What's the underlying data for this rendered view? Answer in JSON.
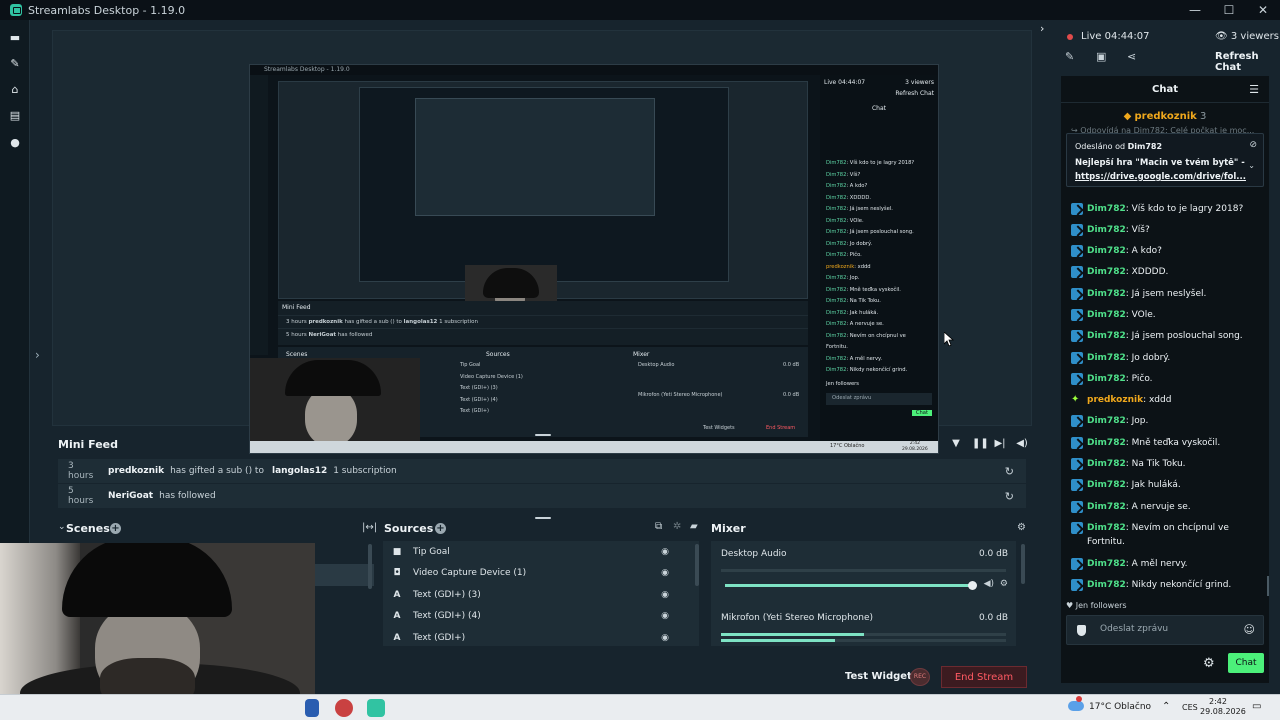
{
  "window": {
    "title": "Streamlabs Desktop - 1.19.0",
    "controls": [
      "—",
      "☐",
      "✕"
    ]
  },
  "nav": {
    "icons": [
      "studio-icon",
      "themes-icon",
      "store-icon",
      "layout-icon",
      "play-icon"
    ]
  },
  "preview": {
    "mini": {
      "title": "Streamlabs Desktop - 1.19.0",
      "live": "Live 04:44:07",
      "viewers": "3 viewers",
      "refresh": "Refresh Chat",
      "chat_title": "Chat",
      "feed_title": "Mini Feed",
      "feed_rows": [
        {
          "time": "3 hours",
          "user": "predkoznik",
          "text": "has gifted a sub () to",
          "target": "langolas12",
          "extra": "1 subscription"
        },
        {
          "time": "5 hours",
          "user": "NeriGoat",
          "text": "has followed"
        }
      ],
      "scenes": "Scenes",
      "sources": "Sources",
      "mixer": "Mixer",
      "source_items": [
        "Tip Goal",
        "Video Capture Device (1)",
        "Text (GDI+) (3)",
        "Text (GDI+) (4)",
        "Text (GDI+)"
      ],
      "mixer_items": [
        {
          "name": "Desktop Audio",
          "db": "0.0 dB"
        },
        {
          "name": "Mikrofon (Yeti Stereo Microphone)",
          "db": "0.0 dB"
        }
      ],
      "test_widgets": "Test Widgets",
      "end_stream": "End Stream",
      "chat_lines": [
        {
          "u": "Dim782",
          "t": "Víš kdo to je lagry 2018?"
        },
        {
          "u": "Dim782",
          "t": "Víš?"
        },
        {
          "u": "Dim782",
          "t": "A kdo?"
        },
        {
          "u": "Dim782",
          "t": "XDDDD."
        },
        {
          "u": "Dim782",
          "t": "Já jsem neslyšel."
        },
        {
          "u": "Dim782",
          "t": "VOle."
        },
        {
          "u": "Dim782",
          "t": "Já jsem poslouchal song."
        },
        {
          "u": "Dim782",
          "t": "Jo dobrý."
        },
        {
          "u": "Dim782",
          "t": "Pičo."
        },
        {
          "u": "predkoznik",
          "t": "xddd"
        },
        {
          "u": "Dim782",
          "t": "Jop."
        },
        {
          "u": "Dim782",
          "t": "Mně teďka vyskočil."
        },
        {
          "u": "Dim782",
          "t": "Na Tik Toku."
        },
        {
          "u": "Dim782",
          "t": "Jak huláká."
        },
        {
          "u": "Dim782",
          "t": "A nervuje se."
        },
        {
          "u": "Dim782",
          "t": "Nevím on chcípnul ve"
        },
        {
          "u": "",
          "t": "Fortnitu."
        },
        {
          "u": "Dim782",
          "t": "A měl nervy."
        },
        {
          "u": "Dim782",
          "t": "Nikdy nekončící grind."
        }
      ],
      "followers": "Jen followers",
      "input_placeholder": "Odeslat zprávu",
      "chat_button": "Chat",
      "taskbar_weather": "17°C Oblačno",
      "taskbar_time": "2:42",
      "taskbar_date": "29.08.2026"
    }
  },
  "minifeed": {
    "title": "Mini Feed",
    "rows": [
      {
        "time": "3 hours",
        "user": "predkoznik",
        "text": "has gifted a sub () to",
        "target": "langolas12",
        "extra": "1 subscription"
      },
      {
        "time": "5 hours",
        "user": "NeriGoat",
        "text": "has followed",
        "target": "",
        "extra": ""
      }
    ]
  },
  "scenes": {
    "title": "Scenes"
  },
  "sources": {
    "title": "Sources",
    "items": [
      {
        "label": "Tip Goal",
        "icon": "gift-icon"
      },
      {
        "label": "Video Capture Device (1)",
        "icon": "camera-icon"
      },
      {
        "label": "Text (GDI+) (3)",
        "icon": "text-icon"
      },
      {
        "label": "Text (GDI+) (4)",
        "icon": "text-icon"
      },
      {
        "label": "Text (GDI+)",
        "icon": "text-icon"
      }
    ]
  },
  "mixer": {
    "title": "Mixer",
    "items": [
      {
        "name": "Desktop Audio",
        "db": "0.0 dB"
      },
      {
        "name": "Mikrofon (Yeti Stereo Microphone)",
        "db": "0.0 dB"
      }
    ]
  },
  "footer": {
    "test_widgets": "Test Widgets",
    "rec": "REC",
    "end_stream": "End Stream"
  },
  "live": {
    "status": "Live 04:44:07",
    "viewers": "3 viewers",
    "refresh": "Refresh Chat"
  },
  "chat": {
    "title": "Chat",
    "pinned_user": "predkoznik",
    "pinned_count": "3",
    "faded_line": "↪ Odpovídá na Dim782: Celé počkat je moc...",
    "reply": {
      "from_label": "Odesláno od",
      "from_user": "Dim782",
      "message": "Nejlepší hra \"Macin ve tvém bytě\" -",
      "link": "https://drive.google.com/drive/fol..."
    },
    "messages": [
      {
        "user": "Dim782",
        "text": "Víš kdo to je lagry 2018?",
        "badge": "dim"
      },
      {
        "user": "Dim782",
        "text": "Víš?",
        "badge": "dim"
      },
      {
        "user": "Dim782",
        "text": "A kdo?",
        "badge": "dim"
      },
      {
        "user": "Dim782",
        "text": "XDDDD.",
        "badge": "dim"
      },
      {
        "user": "Dim782",
        "text": "Já jsem neslyšel.",
        "badge": "dim"
      },
      {
        "user": "Dim782",
        "text": "VOle.",
        "badge": "dim"
      },
      {
        "user": "Dim782",
        "text": "Já jsem poslouchal song.",
        "badge": "dim"
      },
      {
        "user": "Dim782",
        "text": "Jo dobrý.",
        "badge": "dim"
      },
      {
        "user": "Dim782",
        "text": "Pičo.",
        "badge": "dim"
      },
      {
        "user": "predkoznik",
        "text": "xddd",
        "badge": "star"
      },
      {
        "user": "Dim782",
        "text": "Jop.",
        "badge": "dim"
      },
      {
        "user": "Dim782",
        "text": "Mně teďka vyskočil.",
        "badge": "dim"
      },
      {
        "user": "Dim782",
        "text": "Na Tik Toku.",
        "badge": "dim"
      },
      {
        "user": "Dim782",
        "text": "Jak huláká.",
        "badge": "dim"
      },
      {
        "user": "Dim782",
        "text": "A nervuje se.",
        "badge": "dim"
      },
      {
        "user": "Dim782",
        "text": "Nevím on chcípnul ve Fortnitu.",
        "badge": "dim"
      },
      {
        "user": "Dim782",
        "text": "A měl nervy.",
        "badge": "dim"
      },
      {
        "user": "Dim782",
        "text": "Nikdy nekončící grind.",
        "badge": "dim"
      }
    ],
    "followers": "Jen followers",
    "input_placeholder": "Odeslat zprávu",
    "send_button": "Chat"
  },
  "taskbar": {
    "weather": "17°C Oblačno",
    "lang": "CES",
    "time": "2:42",
    "date": "29.08.2026"
  },
  "colors": {
    "accent": "#31c3a2",
    "chat_user": "#4fe08a",
    "gifter": "#f0a81c",
    "end_stream": "#ff5a63",
    "chat_button": "#4cf07a"
  }
}
